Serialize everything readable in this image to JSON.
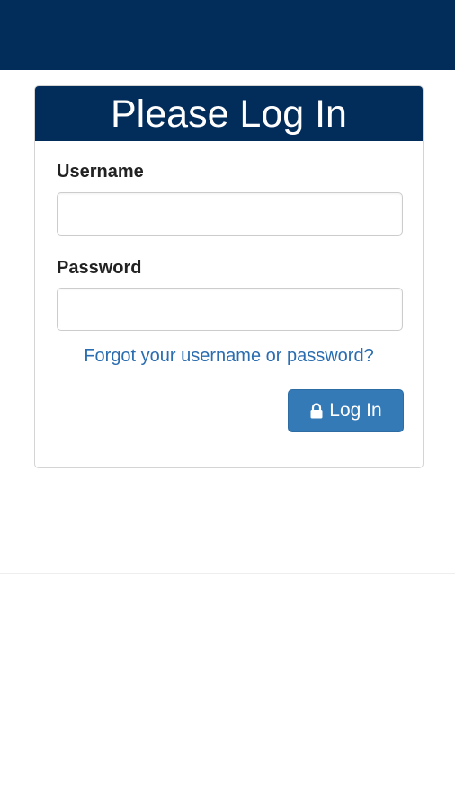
{
  "header": {
    "background_color": "#022c5a"
  },
  "login_card": {
    "title": "Please Log In",
    "username": {
      "label": "Username",
      "value": "",
      "placeholder": ""
    },
    "password": {
      "label": "Password",
      "value": "",
      "placeholder": ""
    },
    "forgot_link": "Forgot your username or password?",
    "login_button": {
      "label": "Log In",
      "icon": "lock-icon",
      "color": "#337ab7"
    }
  },
  "colors": {
    "brand_navy": "#022c5a",
    "link_blue": "#2a6db0"
  }
}
